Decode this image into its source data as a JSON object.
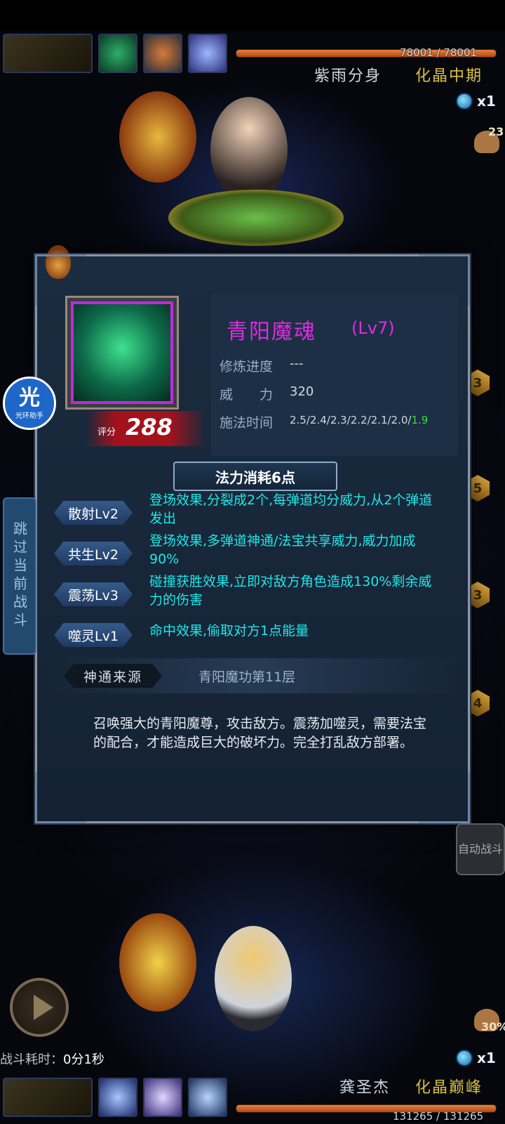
{
  "enemy": {
    "hp_text": "78001 / 78001",
    "name": "紫雨分身",
    "realm": "化晶中期",
    "multiplier": "x1",
    "heart_value": "23"
  },
  "player": {
    "hp_text": "131265 / 131265",
    "name": "龚圣杰",
    "realm": "化晶巅峰",
    "multiplier": "x1",
    "heart_value": "30%"
  },
  "battle": {
    "time_label": "战斗耗时：",
    "time_value": "0分1秒",
    "skip_label": "跳过当前战斗",
    "auto_label": "自动战斗"
  },
  "helper": {
    "main": "光",
    "sub": "光环助手"
  },
  "side_gems": [
    "3",
    "5",
    "3",
    "4"
  ],
  "skill": {
    "name": "青阳魔魂",
    "level": "(Lv7)",
    "progress_label": "修炼进度",
    "progress_value": "---",
    "power_label": "威　　力",
    "power_value": "320",
    "cast_label": "施法时间",
    "cast_value": "2.5/2.4/2.3/2.2/2.1/2.0/",
    "cast_value_highlight": "1.9",
    "score_label": "评分",
    "score_value": "288",
    "mana_cost": "法力消耗6点",
    "effects": [
      {
        "tag": "散射Lv2",
        "text": "登场效果,分裂成2个,每弹道均分威力,从2个弹道发出"
      },
      {
        "tag": "共生Lv2",
        "text": "登场效果,多弹道神通/法宝共享威力,威力加成90%"
      },
      {
        "tag": "震荡Lv3",
        "text": "碰撞获胜效果,立即对敌方角色造成130%剩余威力的伤害"
      },
      {
        "tag": "噬灵Lv1",
        "text": "命中效果,偷取对方1点能量"
      }
    ],
    "source_label": "神通来源",
    "source_value": "青阳魔功第11层",
    "description": "召唤强大的青阳魔尊，攻击敌方。震荡加噬灵，需要法宝的配合，才能造成巨大的破坏力。完全打乱敌方部署。"
  },
  "colors": {
    "skill_name": "#e02be0",
    "effect_text": "#1ee7e7",
    "hp_bar": "#e8823a",
    "cast_highlight": "#3ddc3d"
  }
}
